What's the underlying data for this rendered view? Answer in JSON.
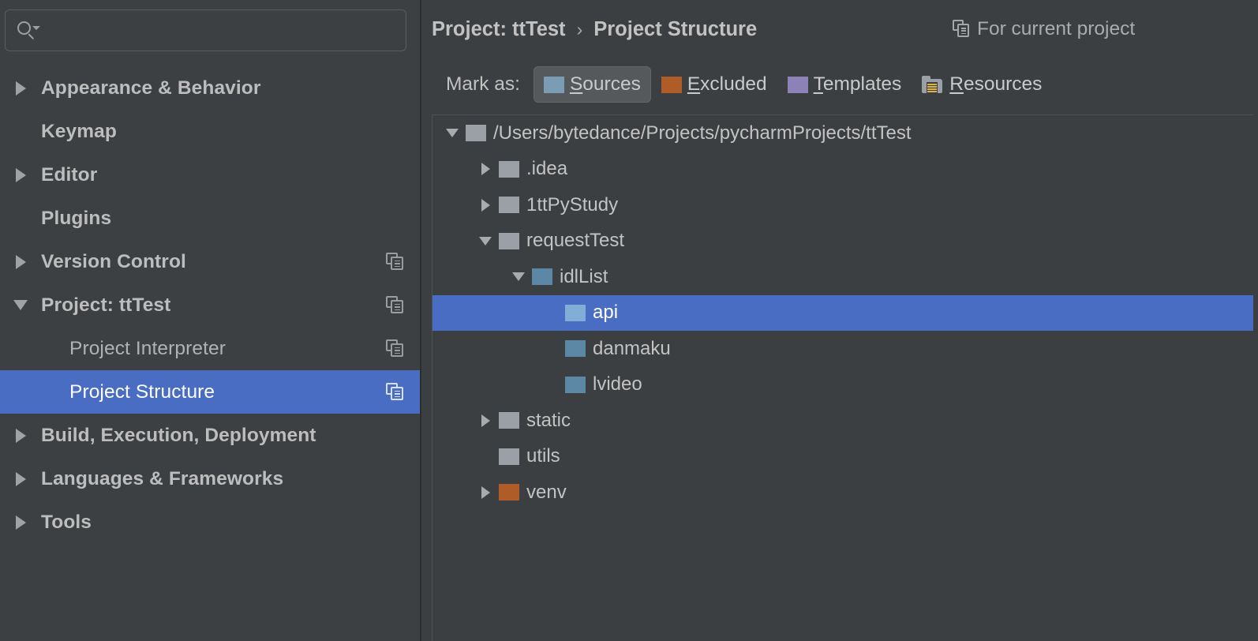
{
  "sidebar": {
    "search": {
      "value": "",
      "placeholder": "",
      "icon": "search-icon"
    },
    "items": [
      {
        "label": "Appearance & Behavior",
        "level": "top",
        "arrow": "collapsed",
        "copy": false,
        "selected": false
      },
      {
        "label": "Keymap",
        "level": "top",
        "arrow": "none",
        "copy": false,
        "selected": false
      },
      {
        "label": "Editor",
        "level": "top",
        "arrow": "collapsed",
        "copy": false,
        "selected": false
      },
      {
        "label": "Plugins",
        "level": "top",
        "arrow": "none",
        "copy": false,
        "selected": false
      },
      {
        "label": "Version Control",
        "level": "top",
        "arrow": "collapsed",
        "copy": true,
        "selected": false
      },
      {
        "label": "Project: ttTest",
        "level": "top",
        "arrow": "expanded",
        "copy": true,
        "selected": false
      },
      {
        "label": "Project Interpreter",
        "level": "child",
        "arrow": "none",
        "copy": true,
        "selected": false
      },
      {
        "label": "Project Structure",
        "level": "child",
        "arrow": "none",
        "copy": true,
        "selected": true
      },
      {
        "label": "Build, Execution, Deployment",
        "level": "top",
        "arrow": "collapsed",
        "copy": false,
        "selected": false
      },
      {
        "label": "Languages & Frameworks",
        "level": "top",
        "arrow": "collapsed",
        "copy": false,
        "selected": false
      },
      {
        "label": "Tools",
        "level": "top",
        "arrow": "collapsed",
        "copy": false,
        "selected": false
      }
    ]
  },
  "header": {
    "breadcrumb": {
      "root": "Project: ttTest",
      "separator": "›",
      "leaf": "Project Structure"
    },
    "for_current_project": {
      "label": "For current project",
      "icon": "copy-pages-icon"
    }
  },
  "toolbar": {
    "mark_as_label": "Mark as:",
    "buttons": [
      {
        "mnemonic": "S",
        "rest": "ources",
        "full": "Sources",
        "icon": "folder-sources-icon",
        "color": "#7a9cb5",
        "active": true
      },
      {
        "mnemonic": "E",
        "rest": "xcluded",
        "full": "Excluded",
        "icon": "folder-excluded-icon",
        "color": "#b05c28",
        "active": false
      },
      {
        "mnemonic": "T",
        "rest": "emplates",
        "full": "Templates",
        "icon": "folder-templates-icon",
        "color": "#8d82b8",
        "active": false
      },
      {
        "mnemonic": "R",
        "rest": "esources",
        "full": "Resources",
        "icon": "folder-resources-icon",
        "color": "#9aa0a6",
        "active": false
      }
    ]
  },
  "tree": {
    "rows": [
      {
        "label": "/Users/bytedance/Projects/pycharmProjects/ttTest",
        "indent": 0,
        "arrow": "expanded",
        "folder": "gray",
        "selected": false
      },
      {
        "label": ".idea",
        "indent": 1,
        "arrow": "collapsed",
        "folder": "gray",
        "selected": false
      },
      {
        "label": "1ttPyStudy",
        "indent": 1,
        "arrow": "collapsed",
        "folder": "gray",
        "selected": false
      },
      {
        "label": "requestTest",
        "indent": 1,
        "arrow": "expanded",
        "folder": "gray",
        "selected": false
      },
      {
        "label": "idlList",
        "indent": 2,
        "arrow": "expanded",
        "folder": "blue",
        "selected": false
      },
      {
        "label": "api",
        "indent": 3,
        "arrow": "none",
        "folder": "selblue",
        "selected": true
      },
      {
        "label": "danmaku",
        "indent": 3,
        "arrow": "none",
        "folder": "blue",
        "selected": false
      },
      {
        "label": "lvideo",
        "indent": 3,
        "arrow": "none",
        "folder": "blue",
        "selected": false
      },
      {
        "label": "static",
        "indent": 1,
        "arrow": "collapsed",
        "folder": "gray",
        "selected": false
      },
      {
        "label": "utils",
        "indent": 1,
        "arrow": "none",
        "folder": "gray",
        "selected": false
      },
      {
        "label": "venv",
        "indent": 1,
        "arrow": "collapsed",
        "folder": "excluded",
        "selected": false
      }
    ]
  },
  "colors": {
    "selection": "#4a6dc4",
    "sidebar_bg": "#3c4043",
    "main_bg": "#3c3f41",
    "sources": "#7a9cb5",
    "excluded": "#b05c28",
    "templates": "#8d82b8",
    "resources": "#9aa0a6"
  }
}
